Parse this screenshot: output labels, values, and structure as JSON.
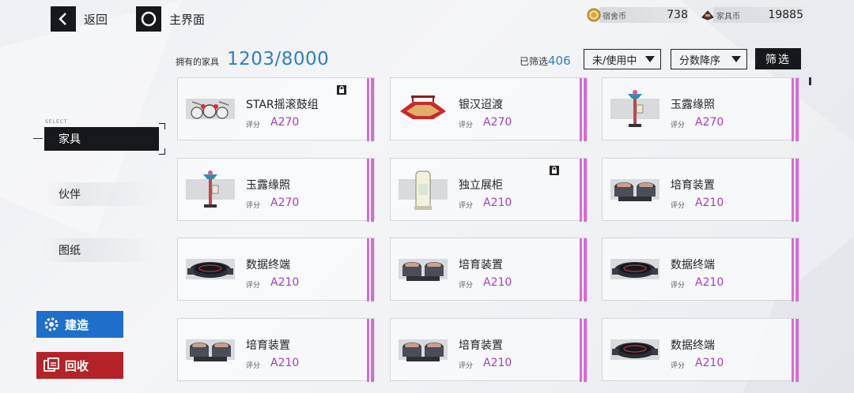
{
  "nav": {
    "back_label": "返回",
    "home_label": "主界面"
  },
  "currencies": [
    {
      "name": "宿舍币",
      "value": "738",
      "icon": "dorm-coin-icon"
    },
    {
      "name": "家具币",
      "value": "19885",
      "icon": "furniture-coin-icon"
    }
  ],
  "header": {
    "owned_label": "拥有的家具",
    "owned_value": "1203/8000",
    "filtered_label": "已筛选",
    "filtered_value": "406",
    "dropdown_usage": "未/使用中",
    "dropdown_sort": "分数降序",
    "filter_button": "筛选"
  },
  "sidebar": {
    "select_tag": "SELECT",
    "items": [
      {
        "label": "家具",
        "active": true
      },
      {
        "label": "伙伴",
        "active": false
      },
      {
        "label": "图纸",
        "active": false
      }
    ],
    "build_label": "建造",
    "recycle_label": "回收"
  },
  "colors": {
    "accent_blue": "#2f7fc1",
    "score_purple": "#a03fc2",
    "rarity_pink": "#d96ad6",
    "build_blue": "#1e6fc9",
    "recycle_red": "#b32328"
  },
  "score_label": "评分",
  "furniture": [
    {
      "name": "STAR摇滚鼓组",
      "score": "A270",
      "locked": true,
      "thumb": "drum-kit"
    },
    {
      "name": "银汉迢渡",
      "score": "A270",
      "locked": false,
      "thumb": "red-bridge"
    },
    {
      "name": "玉露缘照",
      "score": "A270",
      "locked": false,
      "thumb": "lantern-post"
    },
    {
      "name": "玉露缘照",
      "score": "A270",
      "locked": false,
      "thumb": "lantern-post"
    },
    {
      "name": "独立展柜",
      "score": "A210",
      "locked": true,
      "thumb": "display-case"
    },
    {
      "name": "培育装置",
      "score": "A210",
      "locked": false,
      "thumb": "incubator"
    },
    {
      "name": "数据终端",
      "score": "A210",
      "locked": false,
      "thumb": "terminal"
    },
    {
      "name": "培育装置",
      "score": "A210",
      "locked": false,
      "thumb": "incubator"
    },
    {
      "name": "数据终端",
      "score": "A210",
      "locked": false,
      "thumb": "terminal"
    },
    {
      "name": "培育装置",
      "score": "A210",
      "locked": false,
      "thumb": "incubator"
    },
    {
      "name": "培育装置",
      "score": "A210",
      "locked": false,
      "thumb": "incubator"
    },
    {
      "name": "数据终端",
      "score": "A210",
      "locked": false,
      "thumb": "terminal"
    }
  ]
}
